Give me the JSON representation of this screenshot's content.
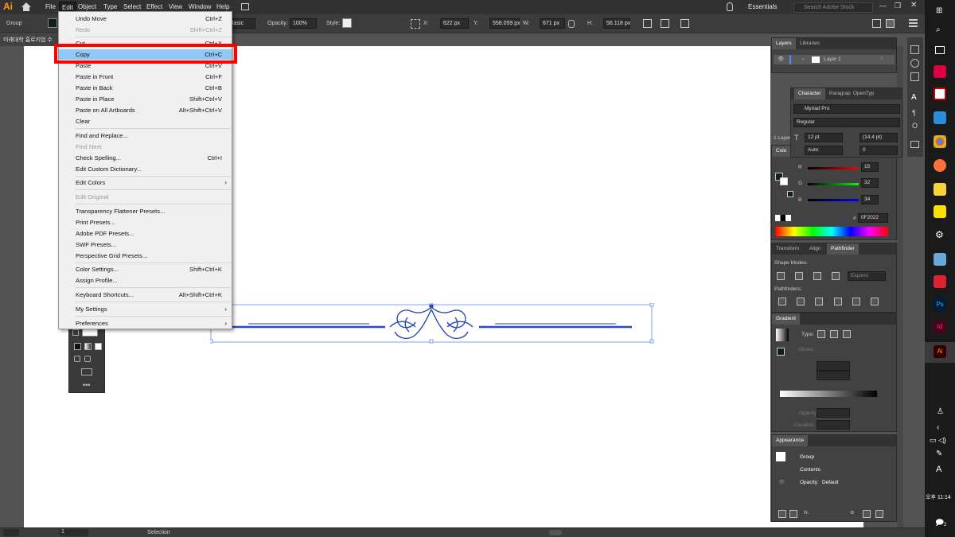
{
  "app": {
    "logo": "Ai"
  },
  "menubar": {
    "items": [
      "File",
      "Edit",
      "Object",
      "Type",
      "Select",
      "Effect",
      "View",
      "Window",
      "Help"
    ],
    "workspace": "Essentials",
    "search_placeholder": "Search Adobe Stock"
  },
  "control_bar": {
    "selection_type": "Group",
    "brush": "Basic",
    "opacity_label": "Opacity:",
    "opacity_value": "100%",
    "style_label": "Style:",
    "x_label": "X:",
    "x_value": "622 px",
    "y_label": "Y:",
    "y_value": "558.059 px",
    "w_label": "W:",
    "w_value": "671 px",
    "h_label": "H:",
    "h_value": "56.118 px"
  },
  "document_tab": "미래대학 홈로키업 수",
  "edit_menu": {
    "items": [
      {
        "label": "Undo Move",
        "shortcut": "Ctrl+Z",
        "disabled": false
      },
      {
        "label": "Redo",
        "shortcut": "Shift+Ctrl+Z",
        "disabled": true
      },
      {
        "label": "Cut",
        "shortcut": "Ctrl+X",
        "disabled": false
      },
      {
        "label": "Copy",
        "shortcut": "Ctrl+C",
        "disabled": false,
        "highlighted": true
      },
      {
        "label": "Paste",
        "shortcut": "Ctrl+V",
        "disabled": false
      },
      {
        "label": "Paste in Front",
        "shortcut": "Ctrl+F",
        "disabled": false
      },
      {
        "label": "Paste in Back",
        "shortcut": "Ctrl+B",
        "disabled": false
      },
      {
        "label": "Paste in Place",
        "shortcut": "Shift+Ctrl+V",
        "disabled": false
      },
      {
        "label": "Paste on All Artboards",
        "shortcut": "Alt+Shift+Ctrl+V",
        "disabled": false
      },
      {
        "label": "Clear",
        "shortcut": "",
        "disabled": false
      },
      {
        "label": "Find and Replace...",
        "shortcut": "",
        "disabled": false
      },
      {
        "label": "Find Next",
        "shortcut": "",
        "disabled": true
      },
      {
        "label": "Check Spelling...",
        "shortcut": "Ctrl+I",
        "disabled": false
      },
      {
        "label": "Edit Custom Dictionary...",
        "shortcut": "",
        "disabled": false
      },
      {
        "label": "Edit Colors",
        "shortcut": "",
        "disabled": false,
        "submenu": true
      },
      {
        "label": "Edit Original",
        "shortcut": "",
        "disabled": true
      },
      {
        "label": "Transparency Flattener Presets...",
        "shortcut": "",
        "disabled": false
      },
      {
        "label": "Print Presets...",
        "shortcut": "",
        "disabled": false
      },
      {
        "label": "Adobe PDF Presets...",
        "shortcut": "",
        "disabled": false
      },
      {
        "label": "SWF Presets...",
        "shortcut": "",
        "disabled": false
      },
      {
        "label": "Perspective Grid Presets...",
        "shortcut": "",
        "disabled": false
      },
      {
        "label": "Color Settings...",
        "shortcut": "Shift+Ctrl+K",
        "disabled": false
      },
      {
        "label": "Assign Profile...",
        "shortcut": "",
        "disabled": false
      },
      {
        "label": "Keyboard Shortcuts...",
        "shortcut": "Alt+Shift+Ctrl+K",
        "disabled": false
      },
      {
        "label": "My Settings",
        "shortcut": "",
        "disabled": false,
        "submenu": true
      },
      {
        "label": "Preferences",
        "shortcut": "",
        "disabled": false,
        "submenu": true
      }
    ]
  },
  "layers_panel": {
    "tabs": [
      "Layers",
      "Libraries"
    ],
    "layer_name": "Layer 1"
  },
  "character_panel": {
    "tabs": [
      "Character",
      "Paragrap",
      "OpenTyp"
    ],
    "font": "Myriad Pro",
    "style": "Regular",
    "size": "12 pt",
    "leading": "(14.4 pt)",
    "kerning": "Auto",
    "tracking": "0",
    "layer_count_label": "1 Layer"
  },
  "color_panel": {
    "tab": "Colo",
    "r_label": "R",
    "r_value": "15",
    "g_label": "G",
    "g_value": "32",
    "b_label": "B",
    "b_value": "34",
    "hex": "0F2022"
  },
  "pathfinder_panel": {
    "tabs": [
      "Transform",
      "Align",
      "Pathfinder"
    ],
    "shape_modes_label": "Shape Modes:",
    "pathfinders_label": "Pathfinders:",
    "expand_label": "Expand"
  },
  "gradient_panel": {
    "tab": "Gradient",
    "type_label": "Type:",
    "stroke_label": "Stroke:",
    "opacity_label": "Opacity:",
    "location_label": "Location:"
  },
  "appearance_panel": {
    "tab": "Appearance",
    "group_label": "Group",
    "contents_label": "Contents",
    "opacity_label": "Opacity:",
    "opacity_value": "Default"
  },
  "status_bar": {
    "zoom": "1",
    "tool": "Selection"
  },
  "taskbar": {
    "time": "오후 11:14",
    "notification_count": "2",
    "lang": "A"
  },
  "colors": {
    "highlight_box": "#ff0000",
    "menu_highlight": "#90c8f6",
    "ornament": "#2a4bb8",
    "ai_orange": "#ff9a00"
  }
}
